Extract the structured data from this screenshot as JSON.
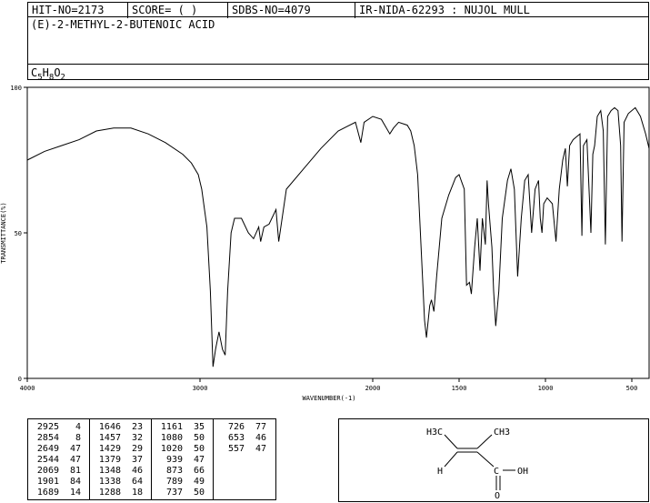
{
  "header": {
    "hit_no": "HIT-NO=2173",
    "score": "SCORE=  (   )",
    "sdbs_no": "SDBS-NO=4079",
    "ir_id": "IR-NIDA-62293 : NUJOL MULL",
    "compound_name": "(E)-2-METHYL-2-BUTENOIC ACID",
    "formula_parts": [
      "C",
      "5",
      "H",
      "8",
      "O",
      "2"
    ]
  },
  "chart_data": {
    "type": "line",
    "xlabel": "WAVENUMBER(-1)",
    "ylabel": "TRANSMITTANCE(%)",
    "xlim": [
      4000,
      400
    ],
    "ylim": [
      0,
      100
    ],
    "x_ticks": [
      4000,
      3000,
      2000,
      1500,
      1000,
      500
    ],
    "y_ticks": [
      0,
      50,
      100
    ],
    "series": [
      {
        "values_note": "",
        "x": [
          4000,
          3900,
          3800,
          3700,
          3600,
          3500,
          3450,
          3400,
          3300,
          3200,
          3100,
          3050,
          3010,
          2990,
          2960,
          2940,
          2925,
          2910,
          2890,
          2870,
          2854,
          2840,
          2820,
          2800,
          2760,
          2720,
          2690,
          2660,
          2649,
          2630,
          2600,
          2560,
          2544,
          2500,
          2400,
          2300,
          2200,
          2100,
          2069,
          2050,
          2000,
          1950,
          1901,
          1880,
          1850,
          1800,
          1780,
          1760,
          1740,
          1720,
          1700,
          1689,
          1670,
          1660,
          1646,
          1630,
          1600,
          1560,
          1520,
          1500,
          1470,
          1457,
          1440,
          1429,
          1410,
          1395,
          1379,
          1365,
          1348,
          1338,
          1330,
          1310,
          1300,
          1288,
          1270,
          1250,
          1220,
          1200,
          1180,
          1161,
          1140,
          1120,
          1100,
          1080,
          1060,
          1040,
          1030,
          1020,
          1010,
          990,
          960,
          939,
          920,
          900,
          885,
          873,
          860,
          840,
          820,
          800,
          789,
          780,
          760,
          737,
          726,
          715,
          700,
          680,
          665,
          653,
          640,
          620,
          600,
          580,
          565,
          557,
          545,
          520,
          480,
          450,
          420,
          400
        ],
        "y": [
          75,
          78,
          80,
          82,
          85,
          86,
          86,
          86,
          84,
          81,
          77,
          74,
          70,
          65,
          52,
          30,
          4,
          10,
          16,
          10,
          8,
          30,
          50,
          55,
          55,
          50,
          48,
          52,
          47,
          52,
          53,
          58,
          47,
          65,
          72,
          79,
          85,
          88,
          81,
          88,
          90,
          89,
          84,
          86,
          88,
          87,
          85,
          80,
          70,
          45,
          20,
          14,
          25,
          27,
          23,
          35,
          55,
          63,
          69,
          70,
          65,
          32,
          33,
          29,
          45,
          55,
          37,
          55,
          46,
          68,
          60,
          45,
          30,
          18,
          30,
          55,
          68,
          72,
          65,
          35,
          55,
          68,
          70,
          50,
          65,
          68,
          55,
          50,
          60,
          62,
          60,
          47,
          65,
          75,
          79,
          66,
          80,
          82,
          83,
          84,
          49,
          80,
          82,
          50,
          77,
          80,
          90,
          92,
          85,
          46,
          90,
          92,
          93,
          92,
          80,
          47,
          88,
          91,
          93,
          90,
          84,
          79
        ]
      }
    ],
    "peak_table": [
      [
        "2925",
        "4"
      ],
      [
        "2854",
        "8"
      ],
      [
        "2649",
        "47"
      ],
      [
        "2544",
        "47"
      ],
      [
        "2069",
        "81"
      ],
      [
        "1901",
        "84"
      ],
      [
        "1689",
        "14"
      ],
      [
        "1646",
        "23"
      ],
      [
        "1457",
        "32"
      ],
      [
        "1429",
        "29"
      ],
      [
        "1379",
        "37"
      ],
      [
        "1348",
        "46"
      ],
      [
        "1338",
        "64"
      ],
      [
        "1288",
        "18"
      ],
      [
        "1161",
        "35"
      ],
      [
        "1080",
        "50"
      ],
      [
        "1020",
        "50"
      ],
      [
        "939",
        "47"
      ],
      [
        "873",
        "66"
      ],
      [
        "789",
        "49"
      ],
      [
        "737",
        "50"
      ],
      [
        "726",
        "77"
      ],
      [
        "653",
        "46"
      ],
      [
        "557",
        "47"
      ]
    ]
  },
  "structure": {
    "labels": [
      "H3C",
      "CH3",
      "H",
      "C",
      "OH",
      "O"
    ]
  }
}
